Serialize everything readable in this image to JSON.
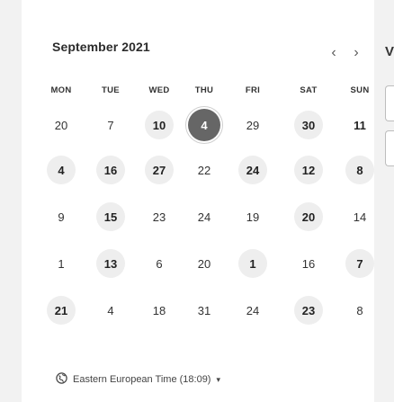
{
  "calendar": {
    "month_label": "September 2021",
    "prev_icon": "chevron-left-icon",
    "next_icon": "chevron-right-icon",
    "prev_glyph": "‹",
    "next_glyph": "›",
    "partial_label": "V",
    "weekdays": [
      "MON",
      "TUE",
      "WED",
      "THU",
      "FRI",
      "SAT",
      "SUN"
    ],
    "weeks": [
      [
        {
          "label": "20",
          "bold": false,
          "available": false
        },
        {
          "label": "7",
          "bold": false,
          "available": false
        },
        {
          "label": "10",
          "bold": true,
          "available": true
        },
        {
          "label": "4",
          "bold": true,
          "available": true,
          "selected": true
        },
        {
          "label": "29",
          "bold": false,
          "available": false
        },
        {
          "label": "30",
          "bold": true,
          "available": true
        },
        {
          "label": "11",
          "bold": true,
          "available": false
        }
      ],
      [
        {
          "label": "4",
          "bold": true,
          "available": true
        },
        {
          "label": "16",
          "bold": true,
          "available": true
        },
        {
          "label": "27",
          "bold": true,
          "available": true
        },
        {
          "label": "22",
          "bold": false,
          "available": false
        },
        {
          "label": "24",
          "bold": true,
          "available": true
        },
        {
          "label": "12",
          "bold": true,
          "available": true
        },
        {
          "label": "8",
          "bold": true,
          "available": true
        }
      ],
      [
        {
          "label": "9",
          "bold": false,
          "available": false
        },
        {
          "label": "15",
          "bold": true,
          "available": true
        },
        {
          "label": "23",
          "bold": false,
          "available": false
        },
        {
          "label": "24",
          "bold": false,
          "available": false
        },
        {
          "label": "19",
          "bold": false,
          "available": false
        },
        {
          "label": "20",
          "bold": true,
          "available": true
        },
        {
          "label": "14",
          "bold": false,
          "available": false
        }
      ],
      [
        {
          "label": "1",
          "bold": false,
          "available": false
        },
        {
          "label": "13",
          "bold": true,
          "available": true
        },
        {
          "label": "6",
          "bold": false,
          "available": false
        },
        {
          "label": "20",
          "bold": false,
          "available": false
        },
        {
          "label": "1",
          "bold": true,
          "available": true
        },
        {
          "label": "16",
          "bold": false,
          "available": false
        },
        {
          "label": "7",
          "bold": true,
          "available": true
        }
      ],
      [
        {
          "label": "21",
          "bold": true,
          "available": true
        },
        {
          "label": "4",
          "bold": false,
          "available": false
        },
        {
          "label": "18",
          "bold": false,
          "available": false
        },
        {
          "label": "31",
          "bold": false,
          "available": false
        },
        {
          "label": "24",
          "bold": false,
          "available": false
        },
        {
          "label": "23",
          "bold": true,
          "available": true
        },
        {
          "label": "8",
          "bold": false,
          "available": false
        }
      ]
    ]
  },
  "timezone": {
    "icon": "globe-icon",
    "label": "Eastern European Time (18:09)",
    "chevron_icon": "caret-down-icon",
    "chevron_glyph": "▾"
  }
}
